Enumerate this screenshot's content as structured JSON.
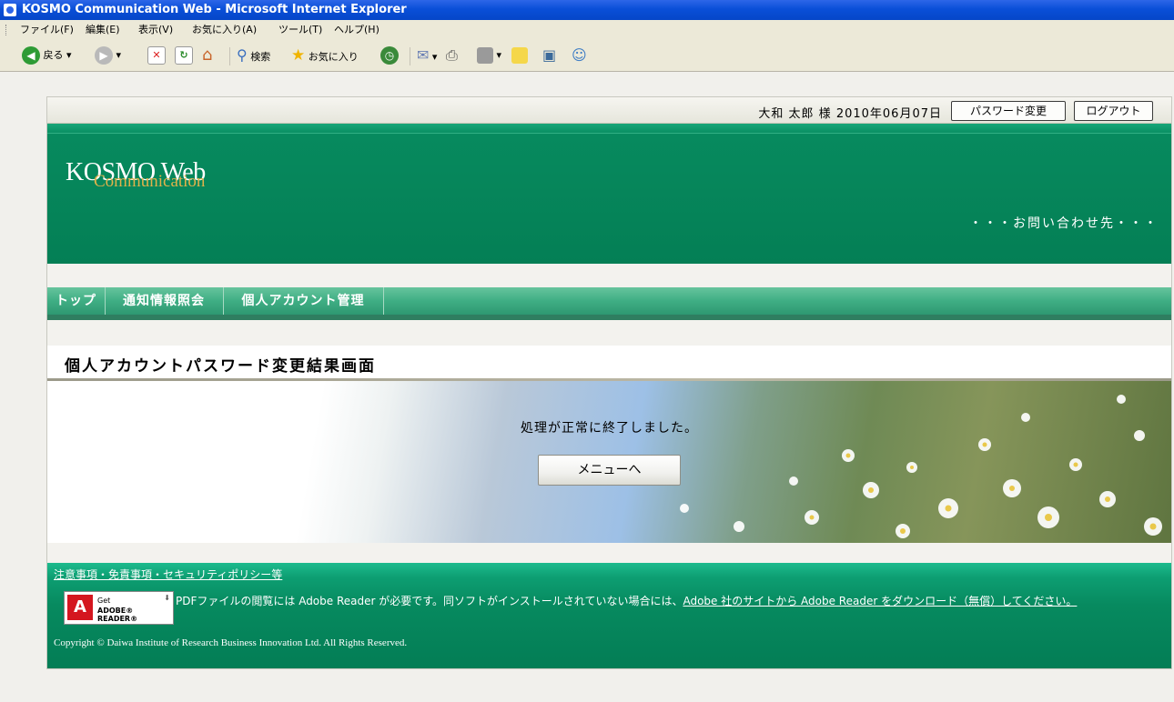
{
  "window": {
    "title": "KOSMO Communication Web - Microsoft Internet Explorer"
  },
  "menubar": {
    "items": [
      "ファイル(F)",
      "編集(E)",
      "表示(V)",
      "お気に入り(A)",
      "ツール(T)",
      "ヘルプ(H)"
    ]
  },
  "toolbar": {
    "back_label": "戻る",
    "search_label": "検索",
    "favorites_label": "お気に入り"
  },
  "userbar": {
    "user_info": "大和 太郎 様 2010年06月07日",
    "change_password_label": "パスワード変更",
    "logout_label": "ログアウト"
  },
  "header": {
    "logo_main": "KOSMO Web",
    "logo_sub": "Communication",
    "contact": "・・・お問い合わせ先・・・"
  },
  "nav": {
    "items": [
      "トップ",
      "通知情報照会",
      "個人アカウント管理"
    ]
  },
  "page": {
    "title": "個人アカウントパスワード変更結果画面",
    "message": "処理が正常に終了しました。",
    "menu_button": "メニューへ"
  },
  "footer": {
    "notice_link": "注意事項・免責事項・セキュリティポリシー等",
    "adobe_badge": {
      "get": "Get",
      "reader": "ADOBE® READER®"
    },
    "pdf_notice": "PDFファイルの閲覧には Adobe Reader が必要です。同ソフトがインストールされていない場合には、",
    "pdf_link": "Adobe 社のサイトから Adobe Reader をダウンロード（無償）してください。",
    "copyright": "Copyright © Daiwa Institute of Research Business Innovation Ltd. All Rights Reserved."
  },
  "colors": {
    "brand_green": "#078a5e",
    "nav_green": "#3fae84",
    "titlebar_blue": "#0a4fd8"
  }
}
